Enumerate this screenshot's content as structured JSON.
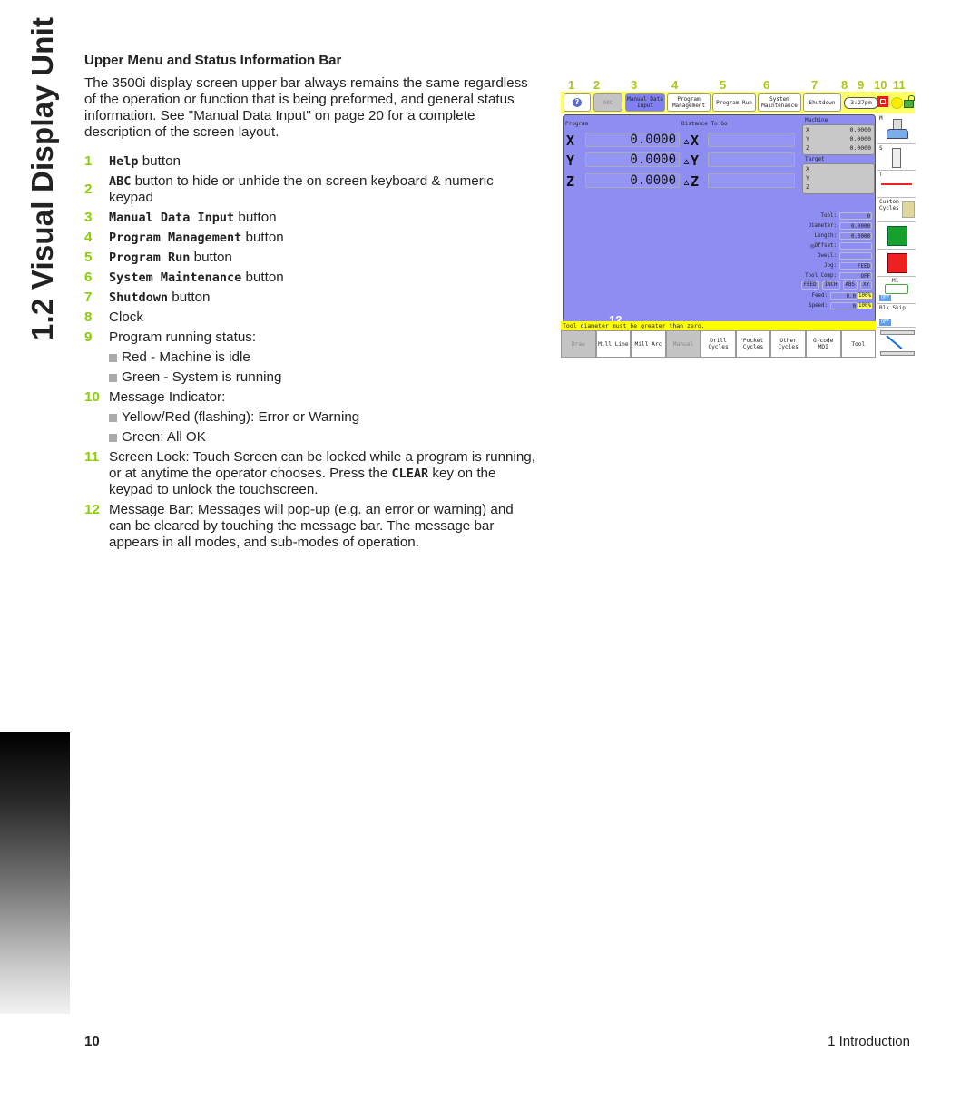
{
  "side_title": "1.2 Visual Display Unit",
  "section": {
    "heading": "Upper Menu and Status Information Bar",
    "intro": "The 3500i display screen upper bar always remains the same regardless of the operation or function that is being preformed, and general status information.  See \"Manual Data Input\" on page 20 for a complete description of the screen layout."
  },
  "items": [
    {
      "num": "1",
      "key": "Help",
      "text": " button"
    },
    {
      "num": "2",
      "key": "ABC",
      "text": " button to hide or unhide the on screen keyboard & numeric keypad"
    },
    {
      "num": "3",
      "key": "Manual Data Input",
      "text": " button"
    },
    {
      "num": "4",
      "key": "Program Management",
      "text": " button"
    },
    {
      "num": "5",
      "key": "Program Run",
      "text": " button"
    },
    {
      "num": "6",
      "key": "System Maintenance",
      "text": " button"
    },
    {
      "num": "7",
      "key": "Shutdown",
      "text": " button"
    },
    {
      "num": "8",
      "text": "Clock"
    },
    {
      "num": "9",
      "text": "Program running status:",
      "subs": [
        "Red - Machine is idle",
        "Green - System is running"
      ]
    },
    {
      "num": "10",
      "text": "Message Indicator:",
      "subs": [
        "Yellow/Red (flashing): Error or Warning",
        "Green: All OK"
      ]
    },
    {
      "num": "11",
      "text_before": "Screen Lock:  Touch Screen can be locked while a program is running, or at anytime the operator chooses.  Press the ",
      "key": "CLEAR",
      "text_after": " key on the keypad to unlock the touchscreen."
    },
    {
      "num": "12",
      "text": "Message Bar: Messages will pop-up (e.g. an error or warning) and can be cleared by touching the message bar.  The message bar appears in all modes, and sub-modes of operation."
    }
  ],
  "figure": {
    "callouts": [
      "1",
      "2",
      "3",
      "4",
      "5",
      "6",
      "7",
      "8",
      "9",
      "10",
      "11"
    ],
    "callout_12": "12",
    "topbar": {
      "help_icon": "?",
      "abc": "ABC",
      "manual_data_input": "Manual Data Input",
      "program_management": "Program Management",
      "program_run": "Program Run",
      "system_maintenance": "System Maintenance",
      "shutdown": "Shutdown",
      "clock": "3:27pm"
    },
    "program_label": "Program",
    "dtg_label": "Distance To Go",
    "axes": [
      {
        "axis": "X",
        "value": "0.0000",
        "dtg_axis": "▵X"
      },
      {
        "axis": "Y",
        "value": "0.0000",
        "dtg_axis": "▵Y"
      },
      {
        "axis": "Z",
        "value": "0.0000",
        "dtg_axis": "▵Z"
      }
    ],
    "machine": {
      "label": "Machine",
      "rows": [
        {
          "a": "X",
          "v": "0.0000"
        },
        {
          "a": "Y",
          "v": "0.0000"
        },
        {
          "a": "Z",
          "v": "0.0000"
        }
      ]
    },
    "target": {
      "label": "Target",
      "rows": [
        "X",
        "Y",
        "Z"
      ]
    },
    "tool_info": {
      "tool": {
        "label": "Tool:",
        "value": "0"
      },
      "diameter": {
        "label": "Diameter:",
        "value": "0.0000"
      },
      "length": {
        "label": "Length:",
        "value": "0.0000"
      },
      "offset": {
        "label": "Offset:",
        "value": ""
      },
      "dwell": {
        "label": "Dwell:",
        "value": ""
      },
      "jog": {
        "label": "Jog:",
        "value": "FEED"
      },
      "tool_comp": {
        "label": "Tool Comp:",
        "value": "OFF"
      },
      "modes": [
        "FEED",
        "INCH",
        "ABS",
        "XY"
      ],
      "feed": {
        "label": "Feed:",
        "value": "0.0",
        "pct": "100%"
      },
      "speed": {
        "label": "Speed:",
        "value": "0",
        "pct": "100%"
      }
    },
    "message": "Tool diameter must be greater than zero.",
    "bottom_buttons": [
      "Draw",
      "Mill Line",
      "Mill Arc",
      "Manual",
      "Drill Cycles",
      "Pocket Cycles",
      "Other Cycles",
      "G-code MDI",
      "Tool"
    ],
    "right_panel": {
      "m": "M",
      "s": "S",
      "t": "T",
      "custom": "Custom Cycles",
      "m1": "M1",
      "m1_state": "OFF",
      "blk_skip": "Blk Skip",
      "blk_state": "OFF"
    }
  },
  "footer": {
    "page": "10",
    "chapter": "1 Introduction"
  }
}
